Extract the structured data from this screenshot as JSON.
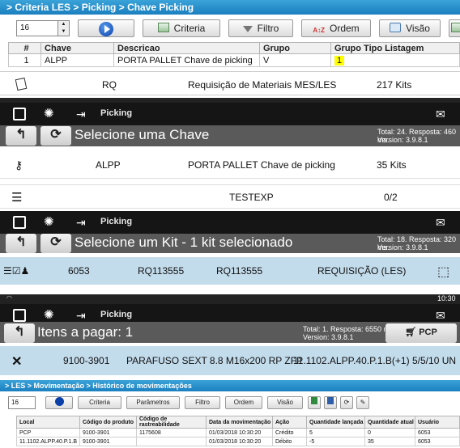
{
  "panel1": {
    "breadcrumb": "> Criteria LES > Picking > Chave Picking",
    "spinner_value": "16",
    "buttons": {
      "criteria": "Criteria",
      "filtro": "Filtro",
      "ordem": "Ordem",
      "visao": "Visão"
    },
    "columns": [
      "#",
      "Chave",
      "Descricao",
      "Grupo",
      "Grupo Tipo Listagem"
    ],
    "rows": [
      {
        "num": "1",
        "chave": "ALPP",
        "descricao": "PORTA PALLET Chave de picking",
        "grupo": "V",
        "grupo_tipo": "1"
      }
    ]
  },
  "panel2": {
    "code": "RQ",
    "description": "Requisição de Materiais MES/LES",
    "count": "217 Kits"
  },
  "panel3": {
    "header_title": "Picking",
    "subtitle": "Selecione uma Chave",
    "info_total": "Total: 24. Resposta: 460 ms.",
    "info_version": "Version: 3.9.8.1",
    "row": {
      "key": "ALPP",
      "description": "PORTA PALLET Chave de picking",
      "count": "35 Kits"
    }
  },
  "panel4": {
    "name": "TESTEXP",
    "count": "0/2"
  },
  "panel5": {
    "header_title": "Picking",
    "subtitle": "Selecione um Kit - 1 kit selecionado",
    "info_total": "Total: 18. Resposta: 320 ms.",
    "info_version": "Version: 3.9.8.1",
    "row": {
      "id": "6053",
      "rq1": "RQ113555",
      "rq2": "RQ113555",
      "type": "REQUISIÇÃO (LES)"
    }
  },
  "panel7": {
    "status_time": "10:30",
    "header_title": "Picking",
    "subtitle": "Itens a pagar: 1",
    "info_total": "Total: 1. Resposta: 6550 ms.",
    "info_version": "Version: 3.9.8.1",
    "pcp_button": "PCP",
    "row": {
      "code": "9100-3901",
      "description": "PARAFUSO SEXT 8.8 M16x200 RP ZFP",
      "location": "11.1102.ALPP.40.P.1.B(+1)",
      "qty": "5/5/10 UN"
    }
  },
  "panel6": {
    "breadcrumb": "> LES > Movimentação > Histórico de movimentações",
    "spinner_value": "16",
    "buttons": {
      "criteria": "Criteria",
      "parametros": "Parâmetros",
      "filtro": "Filtro",
      "ordem": "Ordem",
      "visao": "Visão"
    },
    "columns": [
      "Local",
      "Código do produto",
      "Código de rastreabilidade",
      "Data da movimentação",
      "Ação",
      "Quantidade lançada",
      "Quantidade atual",
      "Usuário"
    ],
    "rows": [
      [
        "PCP",
        "9100-3901",
        "1175608",
        "01/03/2018 10:30:20",
        "Crédito",
        "5",
        "0",
        "6053"
      ],
      [
        "11.1102.ALPP.40.P.1.B",
        "9100-3901",
        "",
        "01/03/2018 10:30:20",
        "Débito",
        "-5",
        "35",
        "6053"
      ]
    ]
  },
  "colors": {
    "accent_blue": "#1b7fbf",
    "row_selected": "#c3dcec",
    "header_dark": "#151515",
    "subheader_gray": "#5a5a5a",
    "highlight": "#ffff00"
  }
}
